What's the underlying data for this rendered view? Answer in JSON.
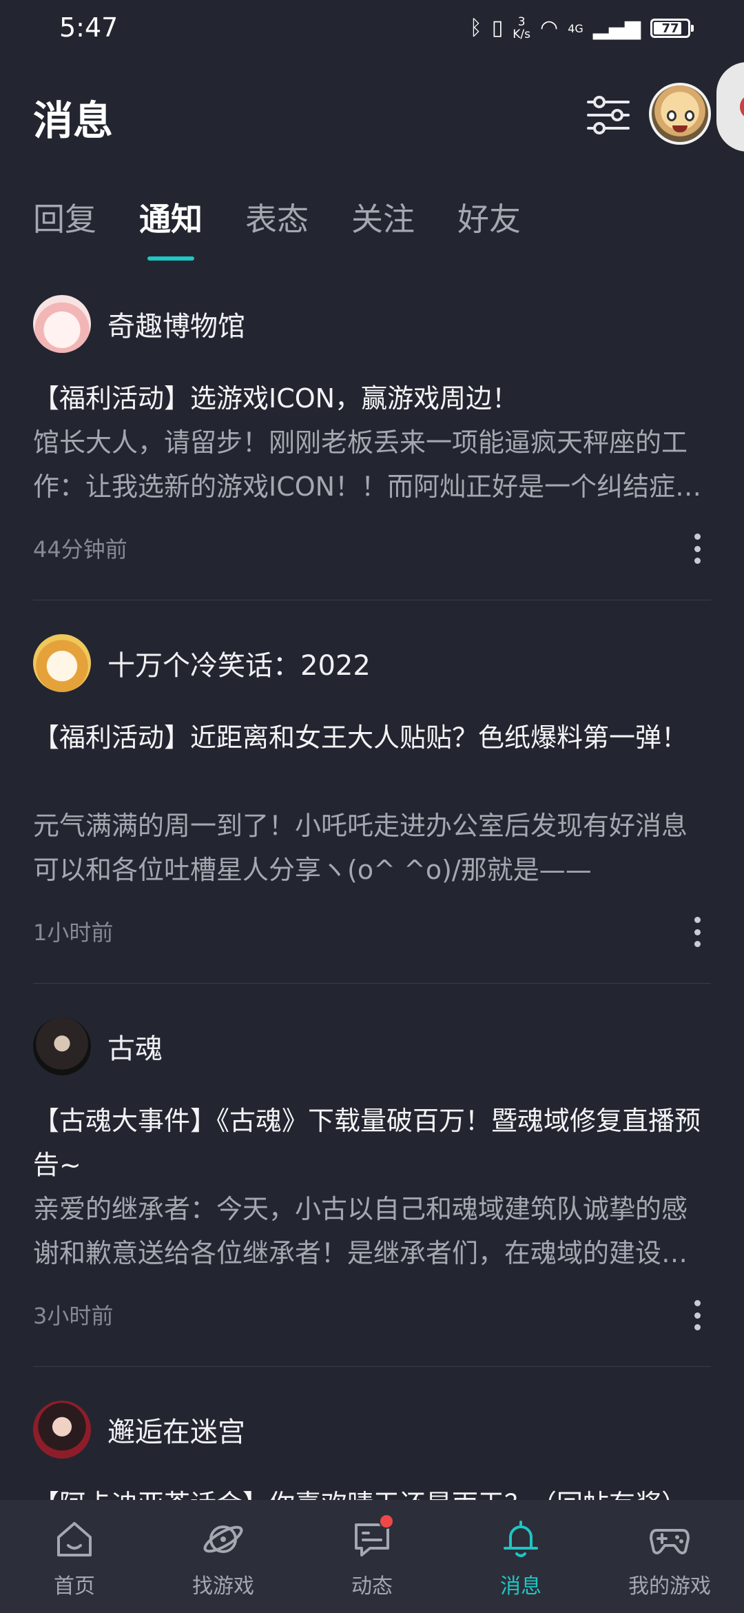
{
  "status_bar": {
    "time": "5:47",
    "net_speed_value": "3",
    "net_speed_unit": "K/s",
    "network": "4G",
    "battery": "77",
    "icons": [
      "bluetooth-icon",
      "vibrate-icon",
      "wifi-icon",
      "signal-icon",
      "battery-icon"
    ]
  },
  "header": {
    "title": "消息",
    "filter_icon": "sliders-icon"
  },
  "tabs": [
    "回复",
    "通知",
    "表态",
    "关注",
    "好友"
  ],
  "active_tab": "通知",
  "notifications": [
    {
      "name": "奇趣博物馆",
      "title": "【福利活动】选游戏ICON，赢游戏周边！",
      "body": "馆长大人，请留步！刚刚老板丢来一项能逼疯天秤座的工作：让我选新的游戏ICON！！而阿灿正好是一个纠结症晚期患者，所以想请馆长大人们帮帮我！",
      "time": "44分钟前"
    },
    {
      "name": "十万个冷笑话：2022",
      "title": "【福利活动】近距离和女王大人贴贴？色纸爆料第一弹！",
      "body": "元气满满的周一到了！小吒吒走进办公室后发现有好消息可以和各位吐槽星人分享ヽ(o^ ^o)/那就是——",
      "time": "1小时前"
    },
    {
      "name": "古魂",
      "title": "【古魂大事件】《古魂》下载量破百万！暨魂域修复直播预告~",
      "body": "亲爱的继承者：今天，小古以自己和魂域建筑队诚挚的感谢和歉意送给各位继承者！是继承者们，在魂域的建设中给予了我们最大的支持。",
      "time": "3小时前"
    },
    {
      "name": "邂逅在迷宫",
      "title": "【阿卡迪亚茶话会】你喜欢晴天还是雨天？（回帖有奖）",
      "body": "",
      "time": ""
    }
  ],
  "bottom_nav": [
    {
      "label": "首页",
      "icon": "home-icon"
    },
    {
      "label": "找游戏",
      "icon": "planet-icon"
    },
    {
      "label": "动态",
      "icon": "feed-icon"
    },
    {
      "label": "消息",
      "icon": "bell-icon"
    },
    {
      "label": "我的游戏",
      "icon": "gamepad-icon"
    }
  ],
  "colors": {
    "background": "#232630",
    "accent": "#1fc6c4",
    "nav_background": "#2c2f39",
    "badge": "#f04848"
  }
}
